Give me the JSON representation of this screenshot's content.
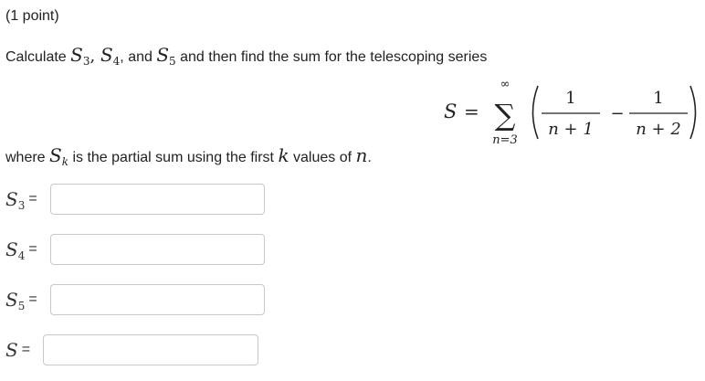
{
  "problem": {
    "points": "(1 point)",
    "intro": {
      "pre": "Calculate ",
      "s3_letter": "S",
      "s3_sub": "3",
      "comma1": ", ",
      "s4_letter": "S",
      "s4_sub": "4",
      "and_text": ", and ",
      "s5_letter": "S",
      "s5_sub": "5",
      "post": " and then find the sum for the telescoping series"
    },
    "formula": {
      "lhs": "S",
      "equals": "=",
      "sigma": "∑",
      "upper_limit": "∞",
      "lower_limit": "n=3",
      "term1_numerator": "1",
      "term1_denominator": "n + 1",
      "minus": "−",
      "term2_numerator": "1",
      "term2_denominator": "n + 2"
    },
    "where": {
      "pre": "where ",
      "sk_letter": "S",
      "sk_sub": "k",
      "mid": " is the partial sum using the first ",
      "k": "k",
      "mid2": " values of ",
      "n": "n",
      "end": "."
    }
  },
  "answers": [
    {
      "letter": "S",
      "sub": "3",
      "equals": "=",
      "value": ""
    },
    {
      "letter": "S",
      "sub": "4",
      "equals": "=",
      "value": ""
    },
    {
      "letter": "S",
      "sub": "5",
      "equals": "=",
      "value": ""
    },
    {
      "letter": "S",
      "sub": "",
      "equals": "=",
      "value": ""
    }
  ]
}
